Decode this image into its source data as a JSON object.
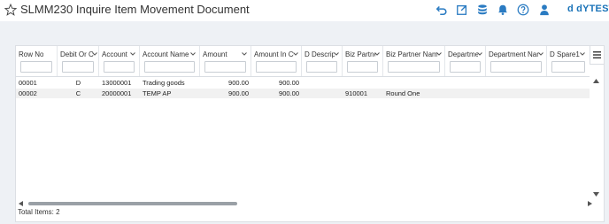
{
  "header": {
    "title": "SLMM230 Inquire Item Movement Document",
    "user": "d dYTEST",
    "icons": [
      "star-icon",
      "undo-icon",
      "open-new-icon",
      "database-icon",
      "bell-icon",
      "help-icon",
      "user-icon"
    ],
    "accent": "#2a7bc2"
  },
  "table": {
    "columns": [
      {
        "label": "Row No"
      },
      {
        "label": "Debit Or C..."
      },
      {
        "label": "Account"
      },
      {
        "label": "Account Name"
      },
      {
        "label": "Amount"
      },
      {
        "label": "Amount In Co..."
      },
      {
        "label": "D Descripti..."
      },
      {
        "label": "Biz Partne..."
      },
      {
        "label": "Biz Partner Name..."
      },
      {
        "label": "Departme..."
      },
      {
        "label": "Department Nam..."
      },
      {
        "label": "D Spare1..."
      }
    ],
    "rows": [
      {
        "row_no": "00001",
        "debit_credit": "D",
        "account": "13000001",
        "account_name": "Trading goods",
        "amount": "900.00",
        "amount_co": "900.00",
        "d_description": "",
        "biz_partner": "",
        "biz_partner_name": "",
        "department": "",
        "department_name": "",
        "d_spare1": ""
      },
      {
        "row_no": "00002",
        "debit_credit": "C",
        "account": "20000001",
        "account_name": "TEMP AP",
        "amount": "900.00",
        "amount_co": "900.00",
        "d_description": "",
        "biz_partner": "910001",
        "biz_partner_name": "Round One",
        "department": "",
        "department_name": "",
        "d_spare1": ""
      }
    ],
    "total_items": "Total Items: 2"
  }
}
